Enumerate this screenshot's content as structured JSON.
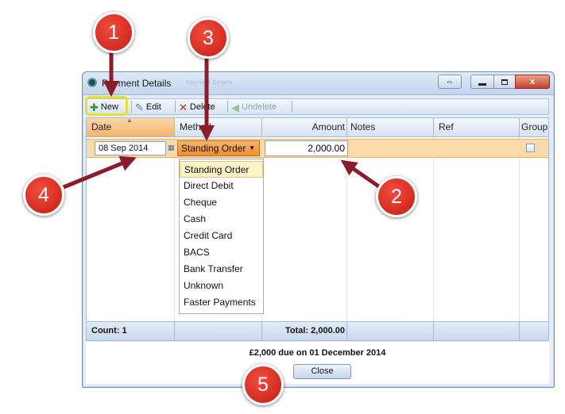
{
  "window": {
    "title": "Payment Details",
    "ghost_title": "Payment Details",
    "expand_glyph": "⇔",
    "close_glyph": "x"
  },
  "toolbar": {
    "new_label": "New",
    "edit_label": "Edit",
    "delete_label": "Delete",
    "undelete_label": "Undelete"
  },
  "grid": {
    "headers": {
      "date": "Date",
      "method": "Method",
      "amount": "Amount",
      "notes": "Notes",
      "ref": "Ref",
      "group": "Group"
    },
    "row": {
      "date": "08 Sep 2014",
      "method": "Standing Order",
      "amount": "2,000.00",
      "notes": "",
      "ref": ""
    },
    "footer": {
      "count": "Count: 1",
      "total": "Total: 2,000.00"
    }
  },
  "dropdown": {
    "options": [
      "Standing Order",
      "Direct Debit",
      "Cheque",
      "Cash",
      "Credit Card",
      "BACS",
      "Bank Transfer",
      "Unknown",
      "Faster Payments"
    ],
    "selected": "Standing Order"
  },
  "summary": {
    "due_text": "£2,000 due on 01 December 2014",
    "close_label": "Close"
  },
  "annotations": {
    "badge_1": "1",
    "badge_2": "2",
    "badge_3": "3",
    "badge_4": "4",
    "badge_5": "5"
  },
  "colors": {
    "badge_red": "#d8241a",
    "arrow": "#8b1d2a",
    "highlight": "#e6e02a",
    "selected_row": "#fbd9a8",
    "method_cell": "#ef902f"
  }
}
